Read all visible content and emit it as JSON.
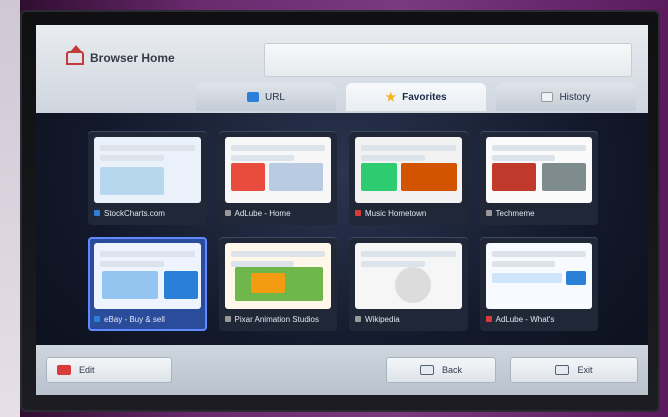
{
  "header": {
    "title": "Browser Home"
  },
  "tabs": [
    {
      "label": "URL",
      "icon": "url-icon",
      "active": false
    },
    {
      "label": "Favorites",
      "icon": "star-icon",
      "active": true
    },
    {
      "label": "History",
      "icon": "history-icon",
      "active": false
    }
  ],
  "tiles": [
    {
      "caption": "StockCharts.com",
      "favicon": "blue"
    },
    {
      "caption": "AdLube - Home",
      "favicon": "gray"
    },
    {
      "caption": "Music Hometown",
      "favicon": "red"
    },
    {
      "caption": "Techmeme",
      "favicon": "gray"
    },
    {
      "caption": "eBay - Buy & sell",
      "favicon": "blue",
      "selected": true
    },
    {
      "caption": "Pixar Animation Studios",
      "favicon": "gray"
    },
    {
      "caption": "Wikipedia",
      "favicon": "gray"
    },
    {
      "caption": "AdLube - What's",
      "favicon": "red"
    }
  ],
  "footer": {
    "edit_label": "Edit",
    "back_label": "Back",
    "exit_label": "Exit"
  },
  "colors": {
    "accent": "#2b4b9b",
    "highlight": "#5f8aff",
    "edit_red": "#d93a3a"
  }
}
